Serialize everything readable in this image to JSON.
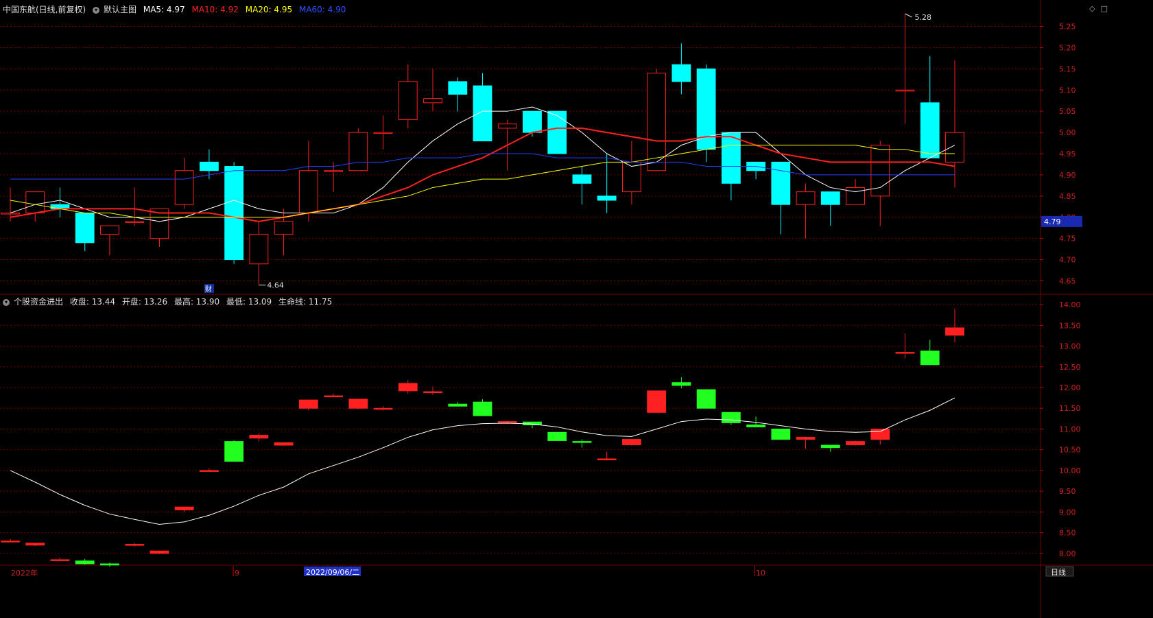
{
  "header_main": {
    "title": "中国东航(日线,前复权)",
    "chart_name": "默认主图",
    "ma5": "MA5: 4.97",
    "ma10": "MA10: 4.92",
    "ma20": "MA20: 4.95",
    "ma60": "MA60: 4.90",
    "icons": [
      "diamond-icon",
      "square-icon"
    ]
  },
  "header_sub": {
    "title": "个股资金进出",
    "close": "收盘: 13.44",
    "open": "开盘: 13.26",
    "high": "最高: 13.90",
    "low": "最低: 13.09",
    "life": "生命线: 11.75"
  },
  "price_tag": "4.79",
  "annotations": {
    "high": "5.28",
    "low": "4.64",
    "fin_marker": "财"
  },
  "bottom_bar": {
    "left": "2022年",
    "mid1": "9",
    "cursor_date": "2022/09/06/二",
    "mid2": "10",
    "right": "日线"
  },
  "colors": {
    "up": "#ff2020",
    "down": "#00ffff",
    "ma5": "#ffffff",
    "ma10": "#ff2020",
    "ma20": "#ffff00",
    "ma60": "#2040ff",
    "flow_up": "#ff2020",
    "flow_down": "#20ff20",
    "life": "#ffffff",
    "grid": "#7a0000"
  },
  "chart_data": [
    {
      "type": "candlestick",
      "title": "中国东航(日线,前复权)",
      "ylim": [
        4.62,
        5.28
      ],
      "yticks": [
        "5.25",
        "5.20",
        "5.15",
        "5.10",
        "5.05",
        "5.00",
        "4.95",
        "4.90",
        "4.85",
        "4.80",
        "4.75",
        "4.70",
        "4.65"
      ],
      "ohlc": [
        [
          4.81,
          4.87,
          4.79,
          4.81
        ],
        [
          4.81,
          4.86,
          4.79,
          4.86
        ],
        [
          4.83,
          4.87,
          4.8,
          4.82
        ],
        [
          4.81,
          4.81,
          4.72,
          4.74
        ],
        [
          4.76,
          4.78,
          4.71,
          4.78
        ],
        [
          4.79,
          4.87,
          4.78,
          4.79
        ],
        [
          4.75,
          4.82,
          4.73,
          4.82
        ],
        [
          4.83,
          4.94,
          4.82,
          4.91
        ],
        [
          4.93,
          4.96,
          4.89,
          4.91
        ],
        [
          4.92,
          4.93,
          4.69,
          4.7
        ],
        [
          4.69,
          4.79,
          4.64,
          4.76
        ],
        [
          4.76,
          4.82,
          4.71,
          4.79
        ],
        [
          4.81,
          4.98,
          4.79,
          4.91
        ],
        [
          4.91,
          4.93,
          4.86,
          4.91
        ],
        [
          4.91,
          5.01,
          4.91,
          5.0
        ],
        [
          5.0,
          5.04,
          4.96,
          5.0
        ],
        [
          5.03,
          5.16,
          5.01,
          5.12
        ],
        [
          5.07,
          5.15,
          5.05,
          5.08
        ],
        [
          5.12,
          5.13,
          5.05,
          5.09
        ],
        [
          5.11,
          5.14,
          4.98,
          4.98
        ],
        [
          5.01,
          5.03,
          4.91,
          5.02
        ],
        [
          5.05,
          5.05,
          4.99,
          5.0
        ],
        [
          5.05,
          5.05,
          4.95,
          4.95
        ],
        [
          4.9,
          4.92,
          4.83,
          4.88
        ],
        [
          4.85,
          4.95,
          4.81,
          4.84
        ],
        [
          4.86,
          4.98,
          4.83,
          4.93
        ],
        [
          4.91,
          5.15,
          4.91,
          5.14
        ],
        [
          5.16,
          5.21,
          5.09,
          5.12
        ],
        [
          5.15,
          5.16,
          4.93,
          4.96
        ],
        [
          5.0,
          5.0,
          4.84,
          4.88
        ],
        [
          4.93,
          4.93,
          4.89,
          4.91
        ],
        [
          4.93,
          4.93,
          4.76,
          4.83
        ],
        [
          4.83,
          4.88,
          4.75,
          4.86
        ],
        [
          4.86,
          4.86,
          4.78,
          4.83
        ],
        [
          4.83,
          4.89,
          4.83,
          4.87
        ],
        [
          4.85,
          4.98,
          4.78,
          4.97
        ],
        [
          5.1,
          5.28,
          5.02,
          5.1
        ],
        [
          5.07,
          5.18,
          4.94,
          4.94
        ],
        [
          4.93,
          5.17,
          4.87,
          5.0
        ]
      ],
      "series": [
        {
          "name": "MA5",
          "values": [
            4.81,
            4.83,
            4.84,
            4.82,
            4.8,
            4.8,
            4.79,
            4.8,
            4.82,
            4.84,
            4.82,
            4.81,
            4.81,
            4.81,
            4.83,
            4.87,
            4.93,
            4.98,
            5.02,
            5.05,
            5.05,
            5.06,
            5.04,
            5.0,
            4.95,
            4.92,
            4.93,
            4.97,
            4.99,
            5.0,
            5.0,
            4.95,
            4.9,
            4.87,
            4.86,
            4.87,
            4.91,
            4.94,
            4.97
          ]
        },
        {
          "name": "MA10",
          "values": [
            4.8,
            4.81,
            4.82,
            4.82,
            4.82,
            4.82,
            4.81,
            4.81,
            4.81,
            4.8,
            4.79,
            4.8,
            4.81,
            4.82,
            4.83,
            4.85,
            4.87,
            4.9,
            4.92,
            4.94,
            4.97,
            5.0,
            5.01,
            5.01,
            5.0,
            4.99,
            4.98,
            4.98,
            4.99,
            4.99,
            4.97,
            4.95,
            4.94,
            4.93,
            4.93,
            4.93,
            4.93,
            4.93,
            4.92
          ]
        },
        {
          "name": "MA20",
          "values": [
            4.84,
            4.83,
            4.82,
            4.81,
            4.81,
            4.8,
            4.8,
            4.8,
            4.8,
            4.8,
            4.8,
            4.8,
            4.81,
            4.82,
            4.83,
            4.84,
            4.85,
            4.87,
            4.88,
            4.89,
            4.89,
            4.9,
            4.91,
            4.92,
            4.93,
            4.93,
            4.94,
            4.95,
            4.96,
            4.97,
            4.97,
            4.97,
            4.97,
            4.97,
            4.97,
            4.96,
            4.96,
            4.95,
            4.95
          ]
        },
        {
          "name": "MA60",
          "values": [
            4.89,
            4.89,
            4.89,
            4.89,
            4.89,
            4.89,
            4.89,
            4.89,
            4.9,
            4.91,
            4.91,
            4.91,
            4.92,
            4.92,
            4.93,
            4.93,
            4.94,
            4.94,
            4.94,
            4.95,
            4.95,
            4.95,
            4.94,
            4.94,
            4.94,
            4.93,
            4.93,
            4.93,
            4.92,
            4.92,
            4.92,
            4.91,
            4.9,
            4.9,
            4.9,
            4.9,
            4.9,
            4.9,
            4.9
          ]
        }
      ]
    },
    {
      "type": "candlestick",
      "title": "个股资金进出",
      "ylim": [
        7.75,
        14.1
      ],
      "yticks": [
        "14.00",
        "13.50",
        "13.00",
        "12.50",
        "12.00",
        "11.50",
        "11.00",
        "10.50",
        "10.00",
        "9.50",
        "9.00",
        "8.50",
        "8.00"
      ],
      "ohlc": [
        [
          8.3,
          8.35,
          8.28,
          8.3
        ],
        [
          8.2,
          8.25,
          8.18,
          8.25
        ],
        [
          7.85,
          7.9,
          7.82,
          7.85
        ],
        [
          7.82,
          7.87,
          7.73,
          7.75
        ],
        [
          7.75,
          7.78,
          7.68,
          7.72
        ],
        [
          8.2,
          8.25,
          8.17,
          8.22
        ],
        [
          8.0,
          8.06,
          7.98,
          8.06
        ],
        [
          9.05,
          9.12,
          9.0,
          9.12
        ],
        [
          10.0,
          10.05,
          9.98,
          10.0
        ],
        [
          10.7,
          10.73,
          10.22,
          10.22
        ],
        [
          10.78,
          10.9,
          10.7,
          10.85
        ],
        [
          10.61,
          10.68,
          10.6,
          10.67
        ],
        [
          11.5,
          11.7,
          11.45,
          11.7
        ],
        [
          11.8,
          11.85,
          11.78,
          11.8
        ],
        [
          11.5,
          11.72,
          11.48,
          11.72
        ],
        [
          11.5,
          11.55,
          11.45,
          11.5
        ],
        [
          11.92,
          12.18,
          11.85,
          12.1
        ],
        [
          11.88,
          12.02,
          11.82,
          11.9
        ],
        [
          11.6,
          11.65,
          11.55,
          11.55
        ],
        [
          11.65,
          11.72,
          11.32,
          11.32
        ],
        [
          11.15,
          11.2,
          11.12,
          11.18
        ],
        [
          11.17,
          11.17,
          11.02,
          11.1
        ],
        [
          10.92,
          10.92,
          10.72,
          10.72
        ],
        [
          10.7,
          10.75,
          10.55,
          10.68
        ],
        [
          10.26,
          10.45,
          10.24,
          10.28
        ],
        [
          10.62,
          10.75,
          10.6,
          10.75
        ],
        [
          11.4,
          11.92,
          11.4,
          11.92
        ],
        [
          12.12,
          12.25,
          11.98,
          12.05
        ],
        [
          11.95,
          11.95,
          11.5,
          11.5
        ],
        [
          11.4,
          11.4,
          11.1,
          11.15
        ],
        [
          11.1,
          11.3,
          11.05,
          11.05
        ],
        [
          11.0,
          11.0,
          10.75,
          10.75
        ],
        [
          10.75,
          10.82,
          10.52,
          10.8
        ],
        [
          10.61,
          10.61,
          10.45,
          10.55
        ],
        [
          10.62,
          10.72,
          10.6,
          10.7
        ],
        [
          10.75,
          10.98,
          10.62,
          11.0
        ],
        [
          12.85,
          13.3,
          12.7,
          12.85
        ],
        [
          12.88,
          13.15,
          12.55,
          12.55
        ],
        [
          13.26,
          13.9,
          13.09,
          13.44
        ]
      ],
      "series": [
        {
          "name": "生命线",
          "values": [
            10.0,
            9.72,
            9.42,
            9.16,
            8.95,
            8.82,
            8.7,
            8.76,
            8.92,
            9.14,
            9.4,
            9.6,
            9.92,
            10.12,
            10.32,
            10.55,
            10.8,
            10.98,
            11.08,
            11.13,
            11.14,
            11.12,
            11.05,
            10.93,
            10.84,
            10.82,
            11.0,
            11.18,
            11.24,
            11.22,
            11.16,
            11.08,
            11.0,
            10.94,
            10.92,
            10.94,
            11.22,
            11.45,
            11.75
          ]
        }
      ]
    }
  ]
}
